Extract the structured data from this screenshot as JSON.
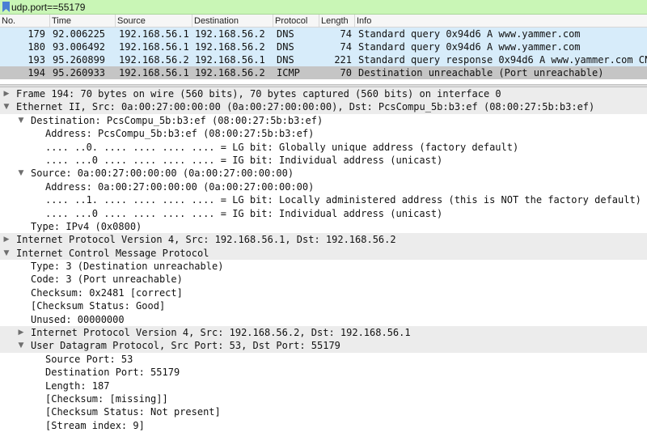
{
  "filter": {
    "value": "udp.port==55179"
  },
  "columns": [
    "No.",
    "Time",
    "Source",
    "Destination",
    "Protocol",
    "Length",
    "Info"
  ],
  "packets": [
    {
      "no": "179",
      "time": "92.006225",
      "src": "192.168.56.1",
      "dst": "192.168.56.2",
      "proto": "DNS",
      "len": "74",
      "info": "Standard query 0x94d6 A www.yammer.com"
    },
    {
      "no": "180",
      "time": "93.006492",
      "src": "192.168.56.1",
      "dst": "192.168.56.2",
      "proto": "DNS",
      "len": "74",
      "info": "Standard query 0x94d6 A www.yammer.com"
    },
    {
      "no": "193",
      "time": "95.260899",
      "src": "192.168.56.2",
      "dst": "192.168.56.1",
      "proto": "DNS",
      "len": "221",
      "info": "Standard query response 0x94d6 A www.yammer.com CN"
    },
    {
      "no": "194",
      "time": "95.260933",
      "src": "192.168.56.1",
      "dst": "192.168.56.2",
      "proto": "ICMP",
      "len": "70",
      "info": "Destination unreachable (Port unreachable)"
    }
  ],
  "details": [
    {
      "t": "Frame 194: 70 bytes on wire (560 bits), 70 bytes captured (560 bits) on interface 0"
    },
    {
      "t": "Ethernet II, Src: 0a:00:27:00:00:00 (0a:00:27:00:00:00), Dst: PcsCompu_5b:b3:ef (08:00:27:5b:b3:ef)"
    },
    {
      "t": "Destination: PcsCompu_5b:b3:ef (08:00:27:5b:b3:ef)"
    },
    {
      "t": "Address: PcsCompu_5b:b3:ef (08:00:27:5b:b3:ef)"
    },
    {
      "t": ".... ..0. .... .... .... .... = LG bit: Globally unique address (factory default)"
    },
    {
      "t": ".... ...0 .... .... .... .... = IG bit: Individual address (unicast)"
    },
    {
      "t": "Source: 0a:00:27:00:00:00 (0a:00:27:00:00:00)"
    },
    {
      "t": "Address: 0a:00:27:00:00:00 (0a:00:27:00:00:00)"
    },
    {
      "t": ".... ..1. .... .... .... .... = LG bit: Locally administered address (this is NOT the factory default)"
    },
    {
      "t": ".... ...0 .... .... .... .... = IG bit: Individual address (unicast)"
    },
    {
      "t": "Type: IPv4 (0x0800)"
    },
    {
      "t": "Internet Protocol Version 4, Src: 192.168.56.1, Dst: 192.168.56.2"
    },
    {
      "t": "Internet Control Message Protocol"
    },
    {
      "t": "Type: 3 (Destination unreachable)"
    },
    {
      "t": "Code: 3 (Port unreachable)"
    },
    {
      "t": "Checksum: 0x2481 [correct]"
    },
    {
      "t": "[Checksum Status: Good]"
    },
    {
      "t": "Unused: 00000000"
    },
    {
      "t": "Internet Protocol Version 4, Src: 192.168.56.2, Dst: 192.168.56.1"
    },
    {
      "t": "User Datagram Protocol, Src Port: 53, Dst Port: 55179"
    },
    {
      "t": "Source Port: 53"
    },
    {
      "t": "Destination Port: 55179"
    },
    {
      "t": "Length: 187"
    },
    {
      "t": "[Checksum: [missing]]"
    },
    {
      "t": "[Checksum Status: Not present]"
    },
    {
      "t": "[Stream index: 9]"
    }
  ],
  "colors": {
    "filter_bg": "#c9f6b6",
    "dns_row": "#d7ecfa",
    "selected_row": "#c5c5c5"
  }
}
